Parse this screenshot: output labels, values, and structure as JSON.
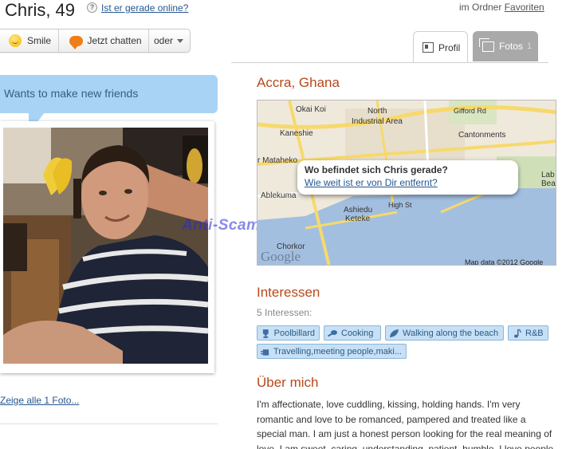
{
  "header": {
    "name_age": "Chris, 49",
    "online_link": "Ist er gerade online?",
    "folder_prefix": "im Ordner",
    "folder_link": "Favoriten"
  },
  "actions": {
    "smile": "Smile",
    "chat": "Jetzt chatten",
    "more": "oder"
  },
  "tabs": {
    "profil": "Profil",
    "fotos": "Fotos",
    "fotos_count": "1"
  },
  "status_bubble": "Wants to make new friends",
  "watermark": "Anti-Scam-Forum-NL",
  "photos_link": "Zeige alle 1 Foto...",
  "location": {
    "title": "Accra, Ghana",
    "map_labels": [
      "Okai Koi",
      "North Industrial Area",
      "Gifford Rd",
      "Kaneshie",
      "Cantonments",
      "Mataheko",
      "Lab Bea",
      "Ablekuma",
      "Ashiedu Keteke",
      "High St",
      "Chorkor"
    ],
    "popup_question": "Wo befindet sich Chris gerade?",
    "popup_link": "Wie weit ist er von Dir entfernt?",
    "map_attribution": "Map data ©2012 Google",
    "map_logo": "Google"
  },
  "interests": {
    "title": "Interessen",
    "count_text": "5 Interessen:",
    "tags": [
      "Poolbillard",
      "Cooking",
      "Walking along the beach",
      "R&B",
      "Travelling,meeting people,maki..."
    ]
  },
  "about": {
    "title": "Über mich",
    "text": "I'm affectionate, love cuddling, kissing, holding hands. I'm very romantic and love to be romanced, pampered and treated like a special man. I am just a honest person looking for the real meaning of love. I am sweet, caring, understanding, patient, humble. I love people who"
  },
  "colors": {
    "accent_title": "#b7481a",
    "link": "#26578f",
    "bubble": "#a9d3f5",
    "tag_bg": "#c7e0f5"
  }
}
